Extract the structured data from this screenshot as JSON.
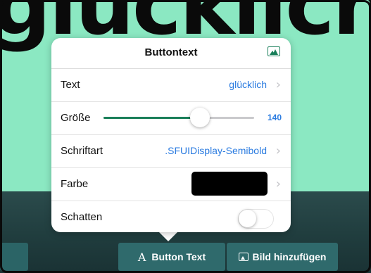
{
  "background": {
    "text": "glücklich"
  },
  "popover": {
    "title": "Buttontext",
    "header_icon": "image-icon",
    "rows": {
      "text": {
        "label": "Text",
        "value": "glücklich"
      },
      "size": {
        "label": "Größe",
        "value": "140",
        "slider_fraction": 0.64
      },
      "font": {
        "label": "Schriftart",
        "value": ".SFUIDisplay-Semibold"
      },
      "color": {
        "label": "Farbe",
        "swatch": "#000000"
      },
      "shadow": {
        "label": "Schatten",
        "enabled": false
      }
    },
    "chevron": "›"
  },
  "toolbar": {
    "button_text": {
      "icon": "A",
      "label": "Button Text"
    },
    "add_image": {
      "icon": "image-icon",
      "label": "Bild hinzufügen"
    }
  },
  "colors": {
    "accent_green": "#1a7f5a",
    "link_blue": "#2a7be0",
    "canvas_mint": "#8be8c2"
  }
}
